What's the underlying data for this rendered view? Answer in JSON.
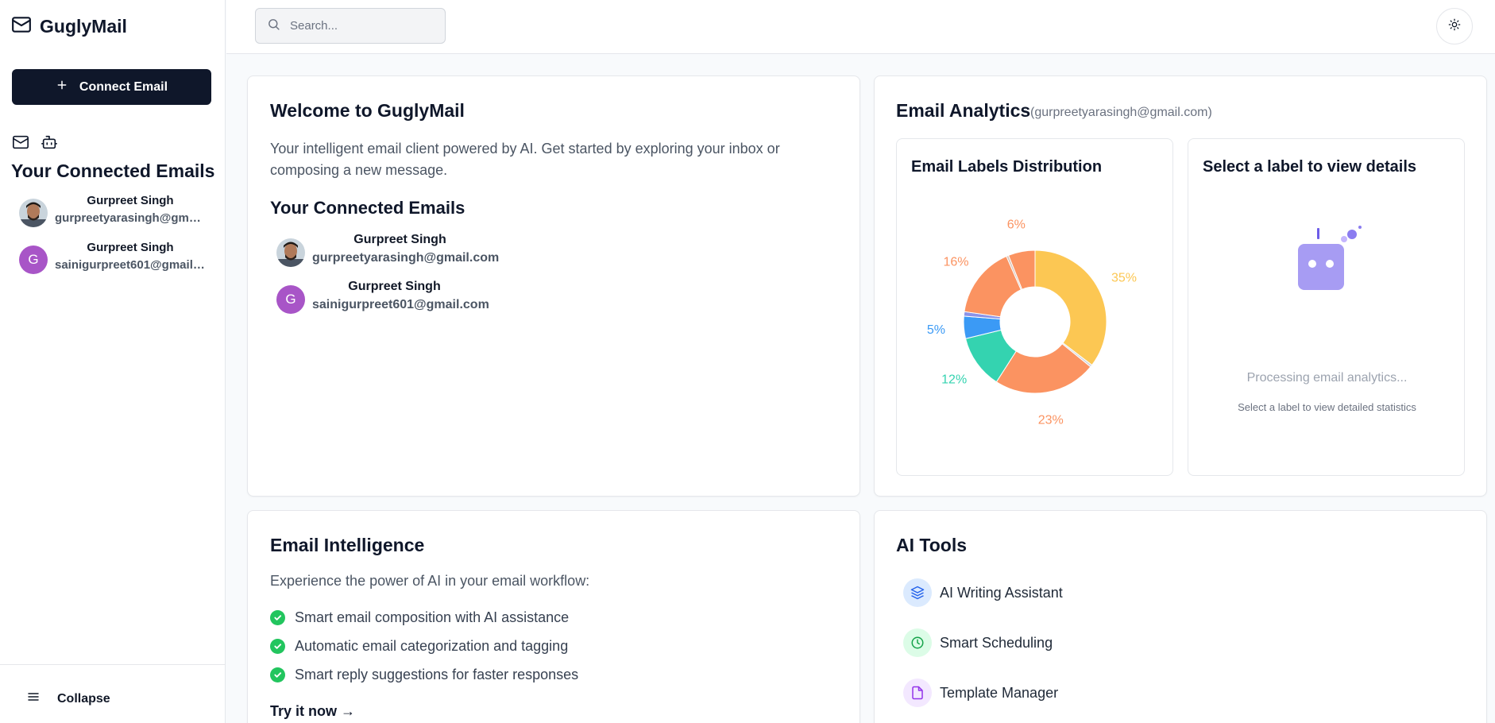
{
  "app": {
    "name": "GuglyMail"
  },
  "sidebar": {
    "connect_label": "Connect Email",
    "heading": "Your Connected Emails",
    "accounts": [
      {
        "name": "Gurpreet Singh",
        "email": "gurpreetyarasingh@gmail.com",
        "avatar": "photo"
      },
      {
        "name": "Gurpreet Singh",
        "email": "sainigurpreet601@gmail.com",
        "avatar_initial": "G",
        "avatar_color": "#a855c7"
      }
    ],
    "collapse_label": "Collapse"
  },
  "header": {
    "search_placeholder": "Search..."
  },
  "welcome": {
    "title": "Welcome to GuglyMail",
    "description": "Your intelligent email client powered by AI. Get started by exploring your inbox or composing a new message.",
    "subheading": "Your Connected Emails",
    "accounts": [
      {
        "name": "Gurpreet Singh",
        "email": "gurpreetyarasingh@gmail.com"
      },
      {
        "name": "Gurpreet Singh",
        "email": "sainigurpreet601@gmail.com",
        "avatar_initial": "G"
      }
    ]
  },
  "analytics": {
    "title": "Email Analytics",
    "account": "(gurpreetyarasingh@gmail.com)",
    "distribution_title": "Email Labels Distribution",
    "details_title": "Select a label to view details",
    "processing": "Processing email analytics...",
    "hint": "Select a label to view detailed statistics"
  },
  "chart_data": {
    "type": "pie",
    "title": "Email Labels Distribution",
    "donut": true,
    "slices": [
      {
        "label": "35%",
        "value": 35,
        "color": "#fcc753"
      },
      {
        "label": "",
        "value": 0.5,
        "color": "#d1d5db"
      },
      {
        "label": "23%",
        "value": 23,
        "color": "#fb9361"
      },
      {
        "label": "12%",
        "value": 12,
        "color": "#34d3b0"
      },
      {
        "label": "5%",
        "value": 5,
        "color": "#3b9af5"
      },
      {
        "label": "",
        "value": 1,
        "color": "#8b93e8"
      },
      {
        "label": "16%",
        "value": 16,
        "color": "#fb9361"
      },
      {
        "label": "",
        "value": 0.5,
        "color": "#d9c4b8"
      },
      {
        "label": "6%",
        "value": 6,
        "color": "#fb9361"
      }
    ]
  },
  "intelligence": {
    "title": "Email Intelligence",
    "description": "Experience the power of AI in your email workflow:",
    "features": [
      "Smart email composition with AI assistance",
      "Automatic email categorization and tagging",
      "Smart reply suggestions for faster responses"
    ],
    "cta": "Try it now →"
  },
  "ai_tools": {
    "title": "AI Tools",
    "items": [
      {
        "label": "AI Writing Assistant",
        "icon": "layers-icon",
        "bg": "#dbeafe",
        "color": "#2563eb"
      },
      {
        "label": "Smart Scheduling",
        "icon": "clock-icon",
        "bg": "#dcfce7",
        "color": "#16a34a"
      },
      {
        "label": "Template Manager",
        "icon": "file-icon",
        "bg": "#f3e8ff",
        "color": "#9333ea"
      }
    ]
  }
}
